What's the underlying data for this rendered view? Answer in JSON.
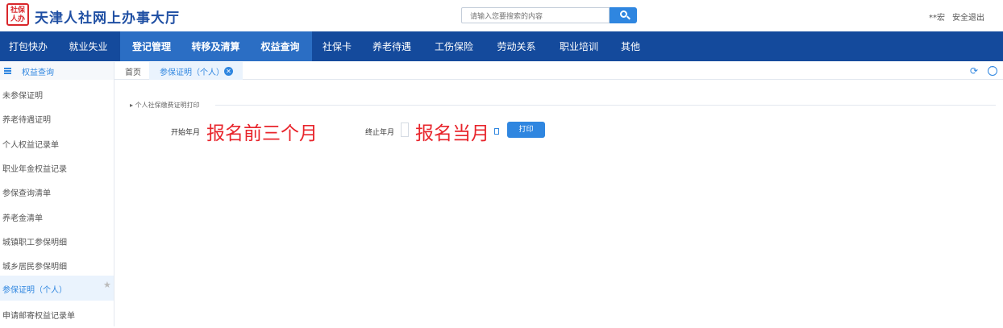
{
  "header": {
    "logo_text": "社保人办",
    "title": "天津人社网上办事大厅",
    "search_placeholder": "请输入您要搜索的内容",
    "user": "**宏",
    "logout": "安全退出"
  },
  "nav": [
    {
      "label": "打包快办"
    },
    {
      "label": "就业失业"
    },
    {
      "label": "登记管理"
    },
    {
      "label": "转移及清算"
    },
    {
      "label": "权益查询"
    },
    {
      "label": "社保卡"
    },
    {
      "label": "养老待遇"
    },
    {
      "label": "工伤保险"
    },
    {
      "label": "劳动关系"
    },
    {
      "label": "职业培训"
    },
    {
      "label": "其他"
    }
  ],
  "tabs": {
    "sidebar_title": "权益查询",
    "home": "首页",
    "active": "参保证明（个人）"
  },
  "sidebar": [
    {
      "label": "未参保证明"
    },
    {
      "label": "养老待遇证明"
    },
    {
      "label": "个人权益记录单"
    },
    {
      "label": "职业年金权益记录"
    },
    {
      "label": "参保查询清单"
    },
    {
      "label": "养老金清单"
    },
    {
      "label": "城镇职工参保明细"
    },
    {
      "label": "城乡居民参保明细"
    },
    {
      "label": "参保证明（个人）"
    },
    {
      "label": "申请邮寄权益记录单"
    }
  ],
  "form": {
    "section_title": "个人社保缴费证明打印",
    "start_label": "开始年月",
    "start_note": "报名前三个月",
    "end_label": "终止年月",
    "end_note": "报名当月",
    "print_button": "打印"
  },
  "colors": {
    "nav_bg": "#144a9c",
    "nav_active": "#2b6ec4",
    "accent": "#2f86e0",
    "annotation_red": "#e8242b"
  }
}
